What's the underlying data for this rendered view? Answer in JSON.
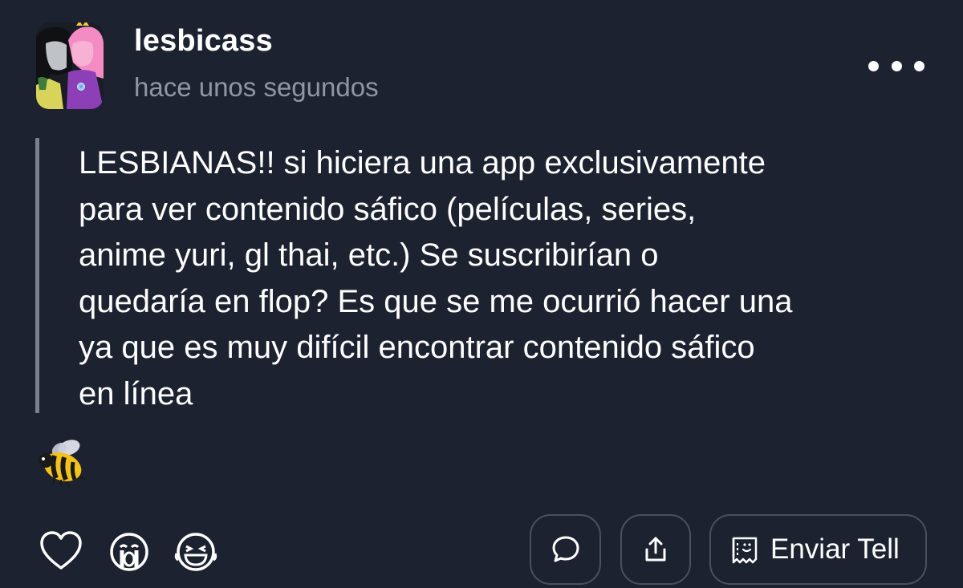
{
  "post": {
    "username": "lesbicass",
    "timestamp": "hace unos segundos",
    "text_lines": [
      "LESBIANAS!! si hiciera una app exclusivamente",
      "para ver contenido sáfico (películas, series,",
      "anime yuri, gl thai, etc.) Se suscribirían o",
      "quedaría en flop? Es que se me ocurrió hacer una",
      "ya que es muy difícil encontrar contenido sáfico",
      "en línea"
    ],
    "sticker_icon": "bee-emoji"
  },
  "actions": {
    "more_icon": "ellipsis-icon",
    "reactions": [
      "heart-icon",
      "crying-face-icon",
      "laughing-face-icon"
    ],
    "comment_icon": "speech-bubble-icon",
    "share_icon": "share-upload-icon",
    "tell_icon": "tell-envelope-icon",
    "tell_label": "Enviar Tell"
  },
  "colors": {
    "background": "#1c2230",
    "primary_text": "#ffffff",
    "secondary_text": "#9096a3",
    "quote_bar": "#7b818c",
    "pill_border": "#4a5060"
  }
}
